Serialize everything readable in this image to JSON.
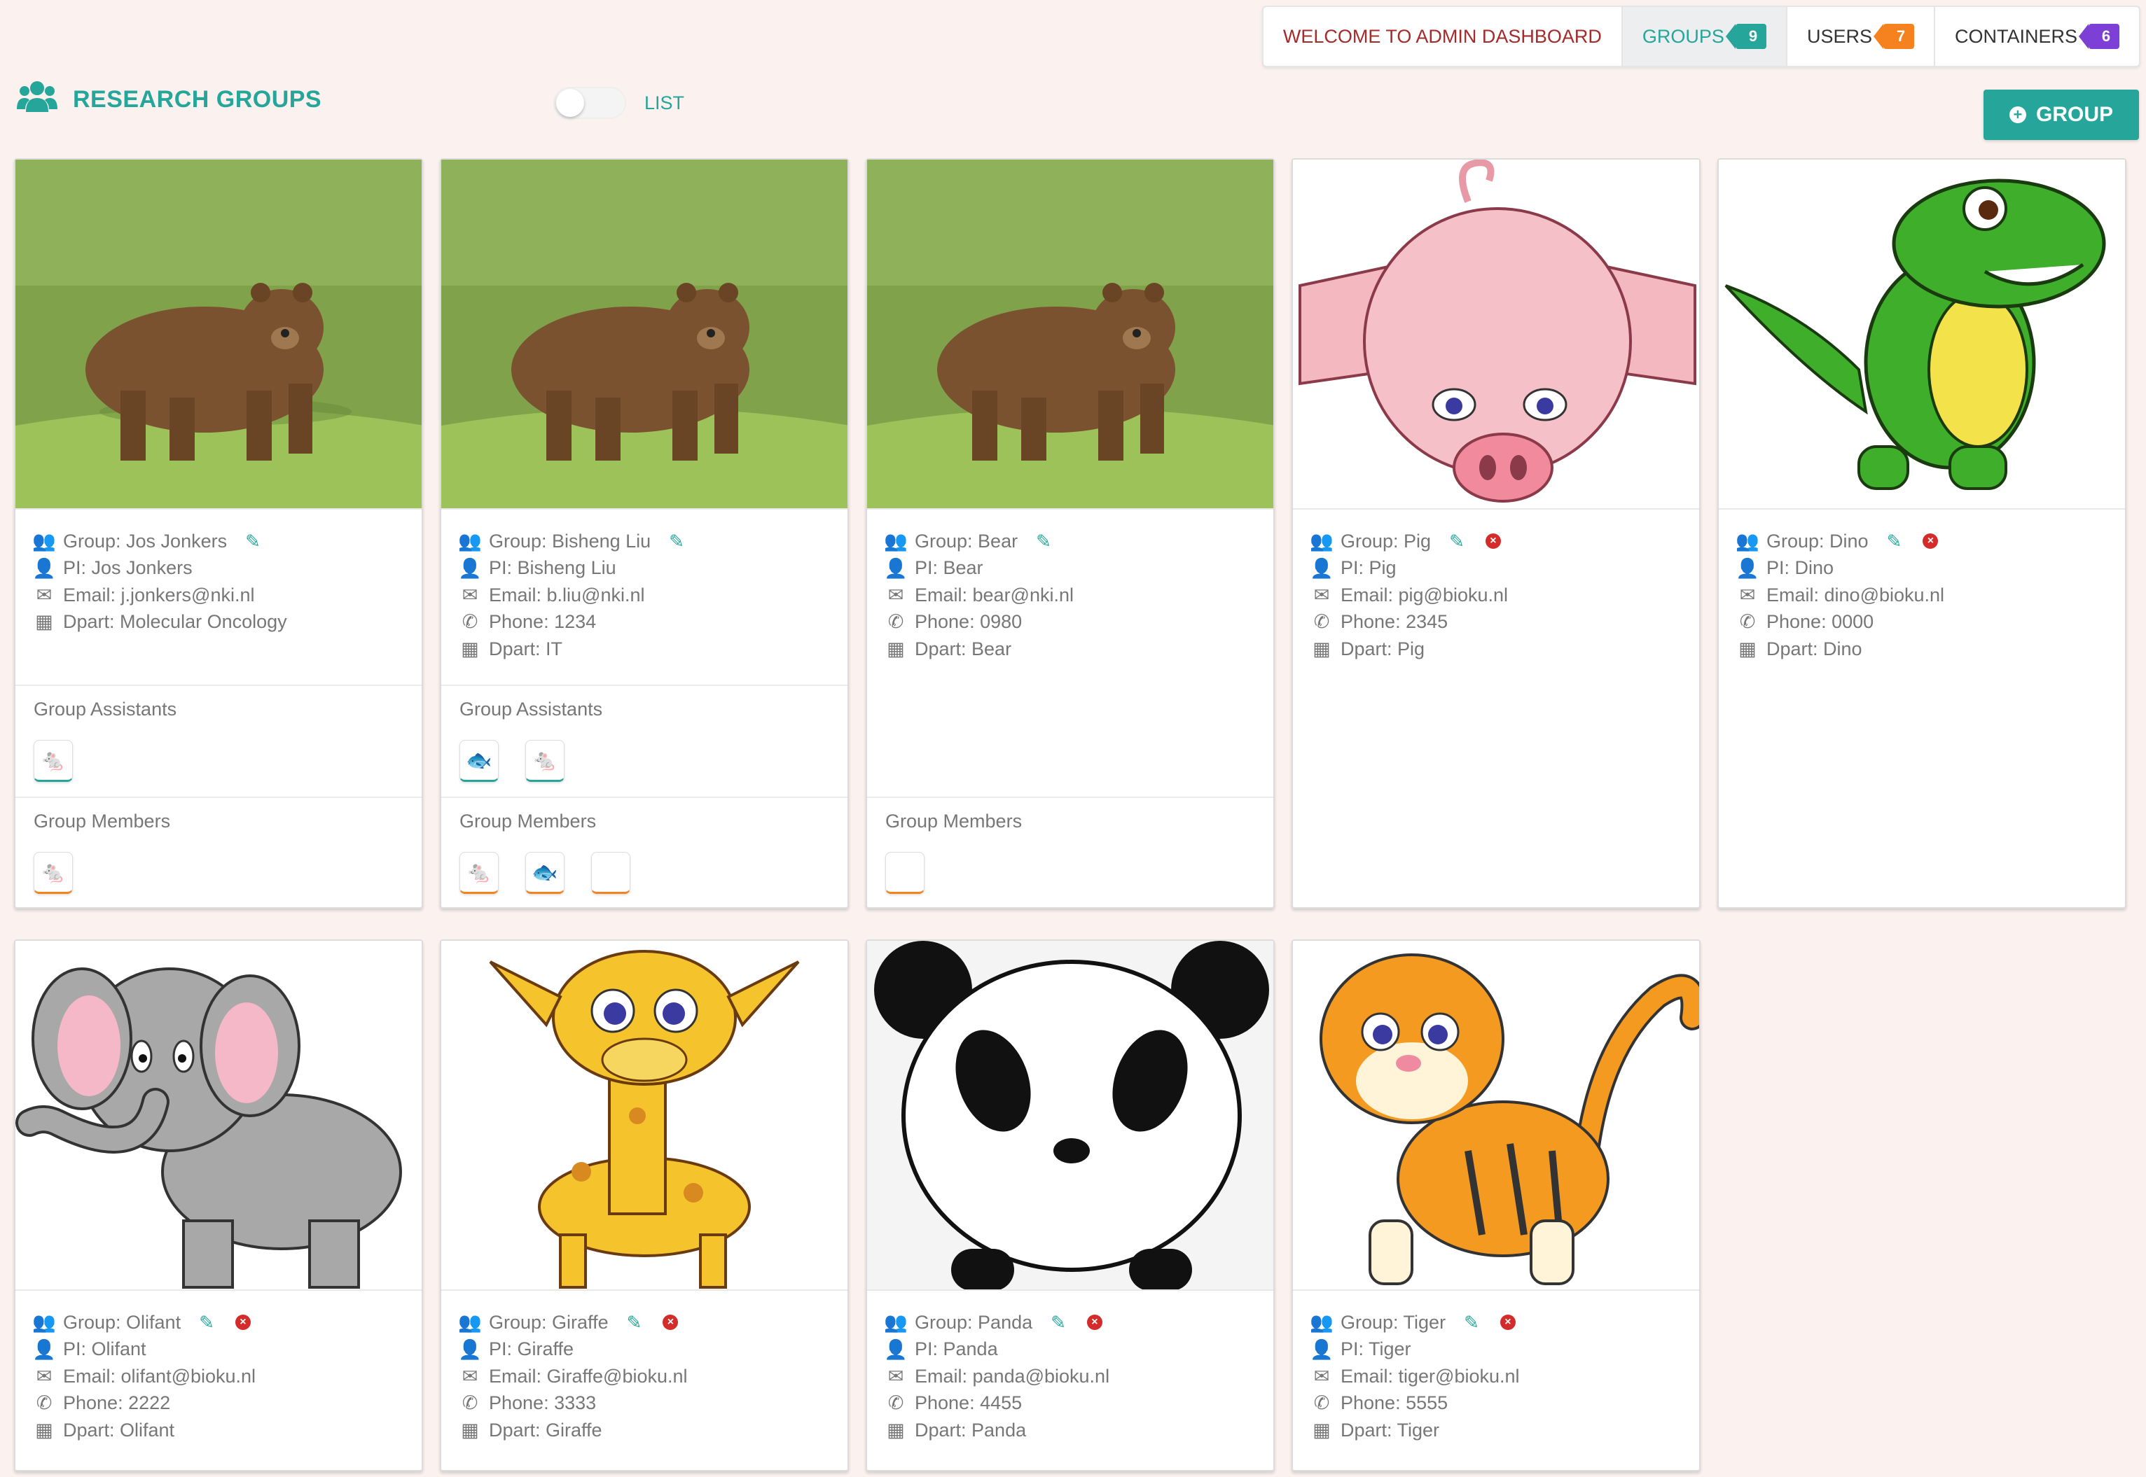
{
  "nav": {
    "welcome": "WELCOME TO ADMIN DASHBOARD",
    "groups": "GROUPS",
    "groups_count": "9",
    "users": "USERS",
    "users_count": "7",
    "containers": "CONTAINERS",
    "containers_count": "6"
  },
  "header": {
    "title": "RESEARCH GROUPS",
    "toggle_label": "LIST",
    "add_button": "GROUP"
  },
  "labels": {
    "assistants": "Group Assistants",
    "members": "Group Members"
  },
  "cards": [
    {
      "group": "Group: Jos Jonkers",
      "pi": "PI: Jos Jonkers",
      "email": "Email: j.jonkers@nki.nl",
      "dpart": "Dpart: Molecular Oncology",
      "image": "bear-photo"
    },
    {
      "group": "Group: Bisheng Liu",
      "pi": "PI: Bisheng Liu",
      "email": "Email: b.liu@nki.nl",
      "phone": "Phone: 1234",
      "dpart": "Dpart: IT",
      "image": "bear-photo"
    },
    {
      "group": "Group: Bear",
      "pi": "PI: Bear",
      "email": "Email: bear@nki.nl",
      "phone": "Phone: 0980",
      "dpart": "Dpart: Bear",
      "image": "bear-photo"
    },
    {
      "group": "Group: Pig",
      "pi": "PI: Pig",
      "email": "Email: pig@bioku.nl",
      "phone": "Phone: 2345",
      "dpart": "Dpart: Pig",
      "image": "pig-cartoon"
    },
    {
      "group": "Group: Dino",
      "pi": "PI: Dino",
      "email": "Email: dino@bioku.nl",
      "phone": "Phone: 0000",
      "dpart": "Dpart: Dino",
      "image": "dino-cartoon"
    },
    {
      "group": "Group: Olifant",
      "pi": "PI: Olifant",
      "email": "Email: olifant@bioku.nl",
      "phone": "Phone: 2222",
      "dpart": "Dpart: Olifant",
      "image": "elephant-cartoon"
    },
    {
      "group": "Group: Giraffe",
      "pi": "PI: Giraffe",
      "email": "Email: Giraffe@bioku.nl",
      "phone": "Phone: 3333",
      "dpart": "Dpart: Giraffe",
      "image": "giraffe-cartoon"
    },
    {
      "group": "Group: Panda",
      "pi": "PI: Panda",
      "email": "Email: panda@bioku.nl",
      "phone": "Phone: 4455",
      "dpart": "Dpart: Panda",
      "image": "panda-cartoon"
    },
    {
      "group": "Group: Tiger",
      "pi": "PI: Tiger",
      "email": "Email: tiger@bioku.nl",
      "phone": "Phone: 5555",
      "dpart": "Dpart: Tiger",
      "image": "tiger-cartoon"
    }
  ],
  "colors": {
    "accent": "#26a69a",
    "users_badge": "#f5811f",
    "containers_badge": "#7e3fd6",
    "delete": "#d42b2b"
  }
}
